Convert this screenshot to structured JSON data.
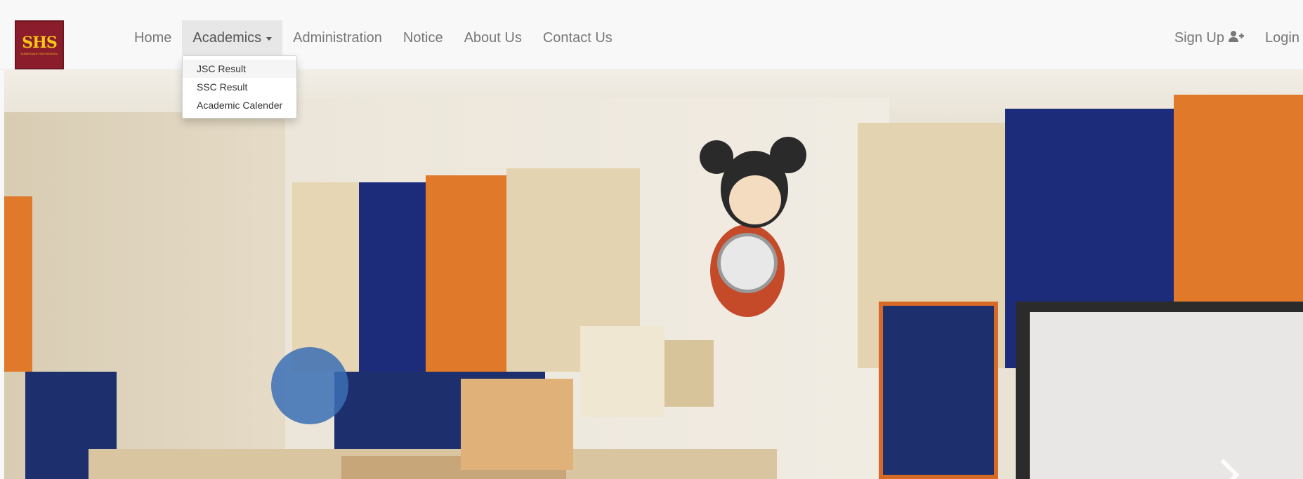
{
  "brand": {
    "logo_text": "SHS",
    "logo_subtext": "SUNNYDALE HIGH SCHOOL"
  },
  "nav": {
    "items": [
      {
        "label": "Home"
      },
      {
        "label": "Academics"
      },
      {
        "label": "Administration"
      },
      {
        "label": "Notice"
      },
      {
        "label": "About Us"
      },
      {
        "label": "Contact Us"
      }
    ],
    "signup_label": "Sign Up",
    "login_label": "Login",
    "signup_icon": "user-plus-icon",
    "login_icon": "sign-in-icon"
  },
  "academics_menu": {
    "items": [
      {
        "label": "JSC Result"
      },
      {
        "label": "SSC Result"
      },
      {
        "label": "Academic Calender"
      }
    ]
  },
  "colors": {
    "navbar_bg": "#f8f8f8",
    "active_tab_bg": "#e7e7e7",
    "logo_bg": "#8b1c2c",
    "logo_text": "#f5c518"
  }
}
